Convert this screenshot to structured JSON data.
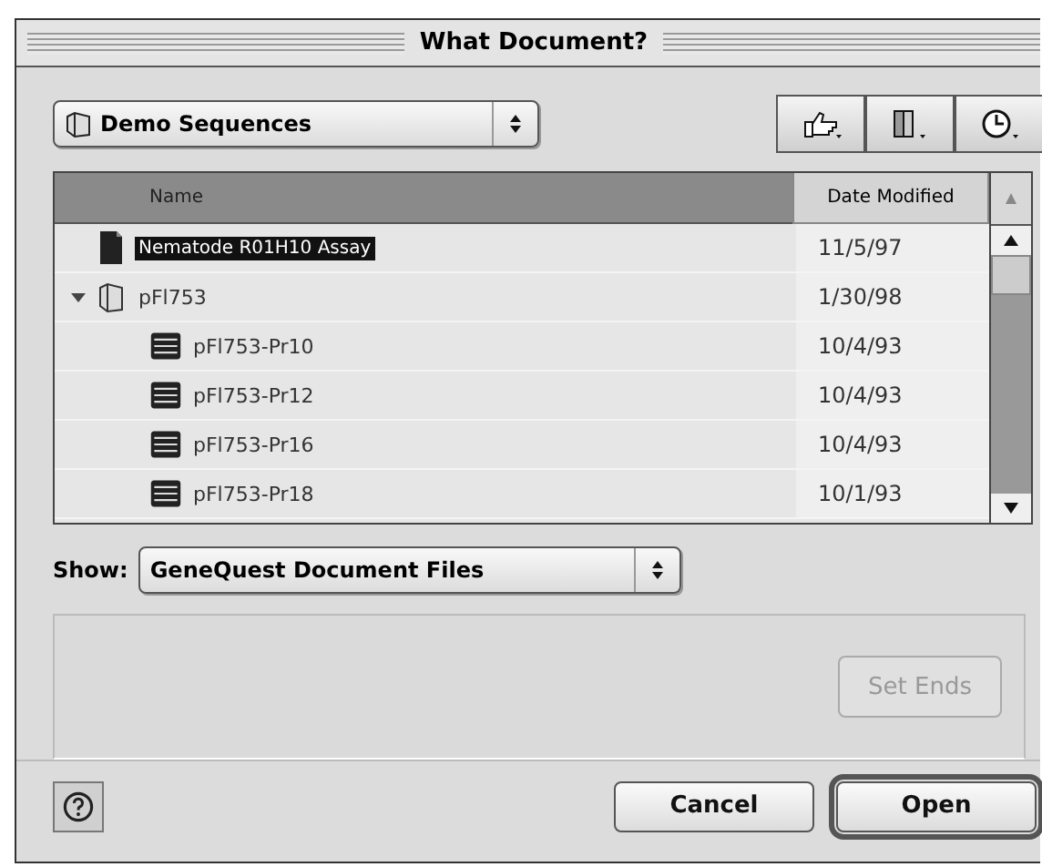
{
  "window": {
    "title": "What Document?"
  },
  "location_popup": {
    "value": "Demo Sequences"
  },
  "file_list": {
    "columns": [
      "Name",
      "Date Modified"
    ],
    "rows": [
      {
        "name": "Nematode R01H10 Assay",
        "date": "11/5/97",
        "kind": "document",
        "selected": true
      },
      {
        "name": "pFl753",
        "date": "1/30/98",
        "kind": "folder",
        "selected": false,
        "expanded": true,
        "children": [
          {
            "name": "pFl753-Pr10",
            "date": "10/4/93",
            "kind": "sequence",
            "selected": false
          },
          {
            "name": "pFl753-Pr12",
            "date": "10/4/93",
            "kind": "sequence",
            "selected": false
          },
          {
            "name": "pFl753-Pr16",
            "date": "10/4/93",
            "kind": "sequence",
            "selected": false
          },
          {
            "name": "pFl753-Pr18",
            "date": "10/1/93",
            "kind": "sequence",
            "selected": false
          }
        ]
      }
    ]
  },
  "show": {
    "label": "Show:",
    "value": "GeneQuest Document Files"
  },
  "set_ends_button": {
    "label": "Set Ends",
    "disabled": true
  },
  "buttons": [
    {
      "label": "Cancel",
      "default": false
    },
    {
      "label": "Open",
      "default": true
    }
  ]
}
